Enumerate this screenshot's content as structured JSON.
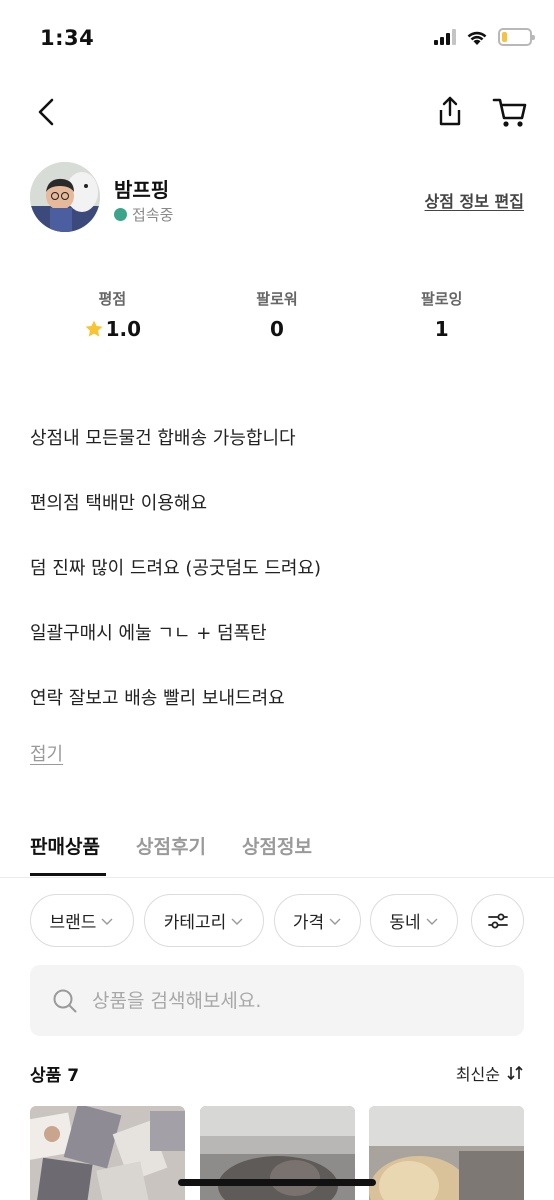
{
  "status_bar": {
    "time": "1:34",
    "battery_level": 0.2,
    "battery_color": "#f5c242"
  },
  "nav": {
    "back_icon": "chevron-left-icon",
    "share_icon": "share-icon",
    "cart_icon": "cart-icon"
  },
  "profile": {
    "shop_name": "밤프핑",
    "status_text": "접속중",
    "status_color": "#3aa58a",
    "edit_link": "상점 정보 편집"
  },
  "stats": [
    {
      "label": "평점",
      "value": "1.0",
      "icon": "star-icon"
    },
    {
      "label": "팔로워",
      "value": "0"
    },
    {
      "label": "팔로잉",
      "value": "1"
    }
  ],
  "description": {
    "lines": [
      "상점내 모든물건 합배송 가능합니다",
      "편의점 택배만 이용해요",
      "덤 진짜 많이 드려요 (공굿덤도 드려요)",
      "일괄구매시 에눌 ㄱㄴ + 덤폭탄",
      "연락 잘보고 배송 빨리 보내드려요"
    ],
    "collapse_label": "접기"
  },
  "tabs": [
    {
      "label": "판매상품",
      "active": true
    },
    {
      "label": "상점후기",
      "active": false
    },
    {
      "label": "상점정보",
      "active": false
    }
  ],
  "filters": [
    {
      "label": "브랜드"
    },
    {
      "label": "카테고리"
    },
    {
      "label": "가격"
    },
    {
      "label": "동네"
    }
  ],
  "filter_settings_icon": "sliders-icon",
  "search": {
    "placeholder": "상품을 검색해보세요.",
    "value": ""
  },
  "products": {
    "count_label": "상품 7",
    "sort_label": "최신순"
  }
}
